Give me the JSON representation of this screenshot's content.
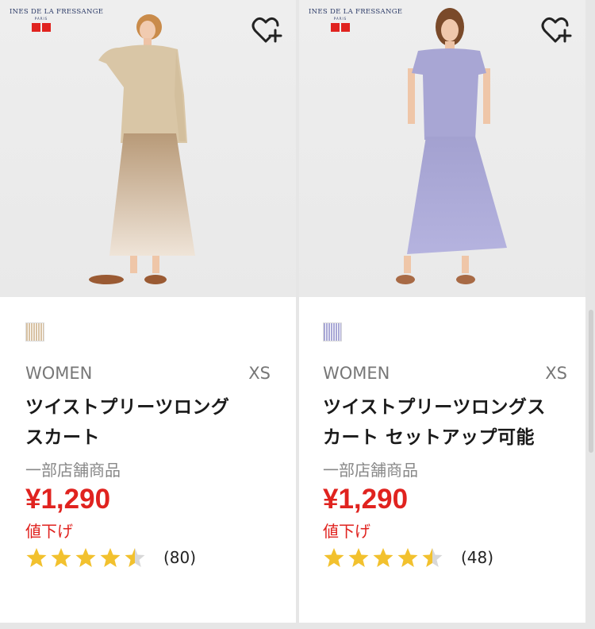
{
  "products": [
    {
      "brand": "INES DE LA FRESSANGE",
      "brand_sub": "PARIS",
      "gender": "WOMEN",
      "size": "XS",
      "title_line1": "ツイストプリーツロング",
      "title_line2": "スカート",
      "availability": "一部店舗商品",
      "price": "¥1,290",
      "sale_label": "値下げ",
      "rating": 4.5,
      "review_count": "(80)",
      "swatch_color": "#d8c2a3",
      "top_color": "#d9c6a6",
      "skirt_color_top": "#b89a78",
      "skirt_color_bottom": "#efe4d8"
    },
    {
      "brand": "INES DE LA FRESSANGE",
      "brand_sub": "PARIS",
      "gender": "WOMEN",
      "size": "XS",
      "title_line1": "ツイストプリーツロングス",
      "title_line2": "カート セットアップ可能",
      "availability": "一部店舗商品",
      "price": "¥1,290",
      "sale_label": "値下げ",
      "rating": 4.5,
      "review_count": "(48)",
      "swatch_color": "#a9a8d6",
      "top_color": "#a8a6d4",
      "skirt_color_top": "#a3a1d0",
      "skirt_color_bottom": "#b5b3df"
    }
  ],
  "colors": {
    "accent_red": "#e0231f",
    "star_gold": "#f2c12e",
    "star_empty": "#d8d8d8"
  }
}
